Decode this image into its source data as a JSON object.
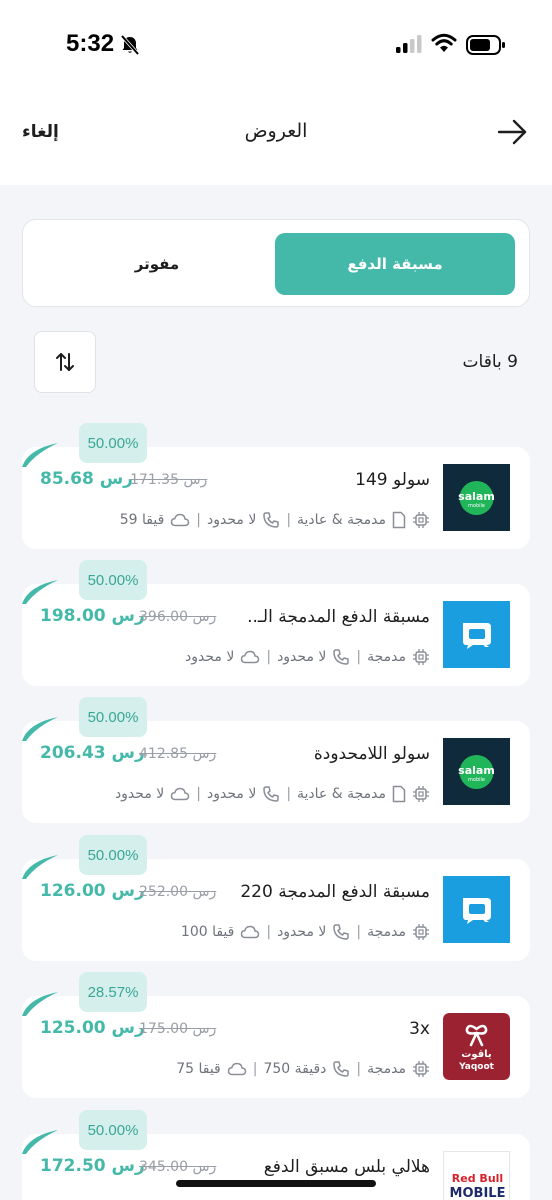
{
  "status_bar": {
    "time": "5:32"
  },
  "header": {
    "title": "العروض",
    "cancel_label": "إلغاء"
  },
  "tabs": {
    "prepaid": "مسبقة الدفع",
    "postpaid": "مفوتر"
  },
  "results": {
    "count_label": "9 باقات"
  },
  "colors": {
    "accent": "#45b9a9",
    "badge_bg": "#d5f0ec",
    "salam_bg": "#0f2a3a",
    "mobily_blue": "#1b9ee0",
    "yaqoot_red": "#9b2230"
  },
  "offers": [
    {
      "discount": "50.00%",
      "name": "سولو 149",
      "price": "85.68 رس",
      "old_price": "171.35 رس",
      "logo": "salam-logo",
      "logo_text": "salam",
      "logo_subtext": "mobile",
      "specs": [
        "مدمجة & عادية",
        "لا محدود",
        "59  قيقا"
      ]
    },
    {
      "discount": "50.00%",
      "name": "مسبقة الدفع المدمجة الـ..",
      "price": "198.00 رس",
      "old_price": "396.00 رس",
      "logo": "mobily-logo",
      "specs": [
        "مدمجة",
        "لا محدود",
        "لا محدود"
      ]
    },
    {
      "discount": "50.00%",
      "name": "سولو اللامحدودة",
      "price": "206.43 رس",
      "old_price": "412.85 رس",
      "logo": "salam-logo",
      "logo_text": "salam",
      "logo_subtext": "mobile",
      "specs": [
        "مدمجة & عادية",
        "لا محدود",
        "لا محدود"
      ]
    },
    {
      "discount": "50.00%",
      "name": "مسبقة الدفع المدمجة 220",
      "price": "126.00 رس",
      "old_price": "252.00 رس",
      "logo": "mobily-logo",
      "specs": [
        "مدمجة",
        "لا محدود",
        "100  قيقا"
      ]
    },
    {
      "discount": "28.57%",
      "name": "3x",
      "price": "125.00 رس",
      "old_price": "175.00 رس",
      "logo": "yaqoot-logo",
      "logo_text": "ياقوت",
      "logo_subtext": "Yaqoot",
      "specs": [
        "مدمجة",
        "750  دقيقة",
        "75  قيقا"
      ]
    },
    {
      "discount": "50.00%",
      "name": "هلالي بلس مسبق الدفع",
      "price": "172.50 رس",
      "old_price": "345.00 رس",
      "logo": "redbull-mobile-logo",
      "logo_text": "Red Bull",
      "logo_subtext": "MOBILE",
      "specs": []
    }
  ]
}
